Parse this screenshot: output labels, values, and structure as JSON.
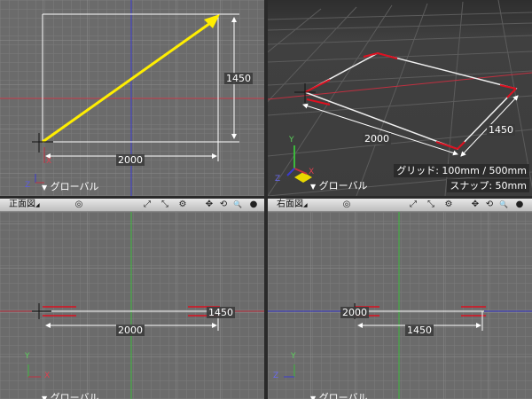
{
  "top_view": {
    "coord_label": "グローバル",
    "axis_x": "X",
    "axis_z": "Z",
    "dim_width": "2000",
    "dim_height": "1450"
  },
  "perspective_view": {
    "coord_label": "グローバル",
    "axis_x": "X",
    "axis_y": "Y",
    "axis_z": "Z",
    "dim_width": "2000",
    "dim_depth": "1450",
    "grid_info": "グリッド: 100mm / 500mm",
    "snap_info": "スナップ: 50mm"
  },
  "front_view": {
    "title": "正面図",
    "coord_label": "グローバル",
    "axis_x": "X",
    "axis_y": "Y",
    "dim_width": "2000",
    "dim_right": "1450"
  },
  "right_view": {
    "title": "右面図",
    "coord_label": "グローバル",
    "axis_y": "Y",
    "axis_z": "Z",
    "dim_left": "2000",
    "dim_width": "1450"
  },
  "toolbar": {
    "menu_indicator": "◢",
    "target_icon": "◎",
    "icons": [
      "rotate-view-icon",
      "fit-view-icon",
      "settings-icon",
      "pan-icon",
      "orbit-icon",
      "zoom-icon",
      "sphere-icon"
    ],
    "icon_glyphs": [
      "⤢",
      "⤡",
      "⚙",
      "✥",
      "⟲",
      "🔍",
      "●"
    ]
  },
  "colors": {
    "viewport_bg": "#6b6b6b",
    "perspective_bg": "#3b3b3b",
    "grid": "#7f7f7f",
    "axis_red": "#c03040",
    "axis_blue": "#3b3bd0",
    "axis_green": "#3cb83c",
    "vector_yellow": "#ffee00",
    "edge_red": "#dd1020"
  }
}
